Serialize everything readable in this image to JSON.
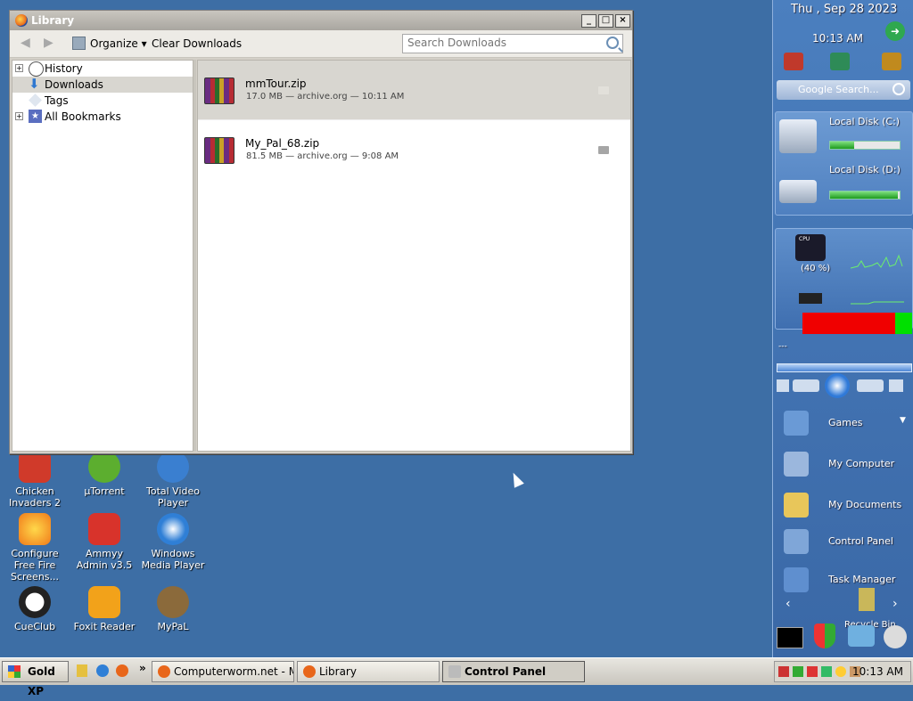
{
  "desktop": {
    "icons": [
      {
        "label": "Chicken Invaders 2",
        "badge": "2",
        "color": "#d03a2a"
      },
      {
        "label": "µTorrent",
        "color": "#5cae2f"
      },
      {
        "label": "Total Video Player",
        "color": "#3a7fd0"
      },
      {
        "label": "Configure Free Fire Screens...",
        "color": "#f07a1a"
      },
      {
        "label": "Ammyy Admin v3.5",
        "color": "#d8332b"
      },
      {
        "label": "Windows Media Player",
        "color": "#2f7fd6"
      },
      {
        "label": "CueClub",
        "color": "#ffffff"
      },
      {
        "label": "Foxit Reader",
        "color": "#f2a21a"
      },
      {
        "label": "MyPaL",
        "color": "#8b6a3b"
      }
    ]
  },
  "library": {
    "title": "Library",
    "toolbar": {
      "back": "back-icon",
      "forward": "forward-icon",
      "organize_label": "Organize",
      "clear_label": "Clear Downloads",
      "search_placeholder": "Search Downloads"
    },
    "sidebar": [
      {
        "label": "History",
        "icon": "clock-icon",
        "expandable": true
      },
      {
        "label": "Downloads",
        "icon": "download-arrow-icon",
        "expandable": false,
        "selected": true
      },
      {
        "label": "Tags",
        "icon": "tag-icon",
        "expandable": false
      },
      {
        "label": "All Bookmarks",
        "icon": "star-icon",
        "expandable": true
      }
    ],
    "downloads": [
      {
        "name": "mmTour.zip",
        "meta": "17.0 MB — archive.org — 10:11 AM",
        "selected": true
      },
      {
        "name": "My_Pal_68.zip",
        "meta": "81.5 MB — archive.org — 9:08 AM",
        "selected": false
      }
    ]
  },
  "sidebar_gadgets": {
    "date": "Thu , Sep 28 2023",
    "time": "10:13 AM",
    "search_placeholder": "Google Search...",
    "disks": [
      {
        "label": "Local Disk (C:)",
        "used": 0.35
      },
      {
        "label": "Local Disk (D:)",
        "used": 0.98
      }
    ],
    "cpu_label": "CPU",
    "cpu_percent": "(40 %)",
    "media_title": "---",
    "menu": [
      {
        "label": "Games",
        "color": "#6a9ad6"
      },
      {
        "label": "My Computer",
        "color": "#9bb7dd"
      },
      {
        "label": "My Documents",
        "color": "#e8c65a"
      },
      {
        "label": "Control Panel",
        "color": "#7fa6d8"
      },
      {
        "label": "Task Manager",
        "color": "#5f8fcf"
      }
    ],
    "recycle_label": "Recycle Bin"
  },
  "taskbar": {
    "start_label": "Gold XP",
    "tasks": [
      {
        "label": "Computerworm.net - Mo...",
        "active": false
      },
      {
        "label": "Library",
        "active": false
      },
      {
        "label": "Control Panel",
        "active": true
      }
    ],
    "clock": "10:13 AM"
  }
}
